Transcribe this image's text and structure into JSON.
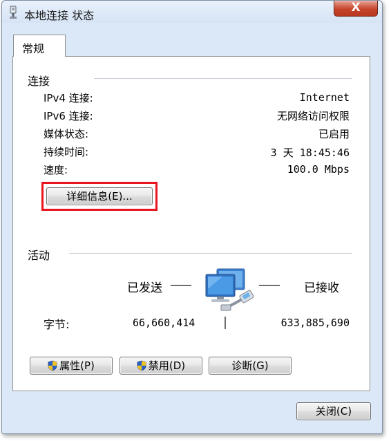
{
  "window": {
    "title": "本地连接 状态",
    "close_label": "X"
  },
  "tabs": [
    {
      "label": "常规"
    }
  ],
  "connection": {
    "heading": "连接",
    "rows": [
      {
        "label": "IPv4 连接:",
        "value": "Internet"
      },
      {
        "label": "IPv6 连接:",
        "value": "无网络访问权限"
      },
      {
        "label": "媒体状态:",
        "value": "已启用"
      },
      {
        "label": "持续时间:",
        "value": "3 天 18:45:46"
      },
      {
        "label": "速度:",
        "value": "100.0 Mbps"
      }
    ],
    "details_button": "详细信息(E)..."
  },
  "activity": {
    "heading": "活动",
    "sent_label": "已发送",
    "received_label": "已接收",
    "bytes_label": "字节:",
    "bytes_sent": "66,660,414",
    "bytes_received": "633,885,690"
  },
  "buttons": {
    "properties": "属性(P)",
    "disable": "禁用(D)",
    "diagnose": "诊断(G)",
    "close": "关闭(C)"
  },
  "colors": {
    "highlight_box": "#e8141e",
    "window_frame": "#dbe8f7",
    "close_button": "#c7442c"
  },
  "icons": [
    "network-adapter-icon",
    "shield-icon",
    "network-computers-icon"
  ]
}
